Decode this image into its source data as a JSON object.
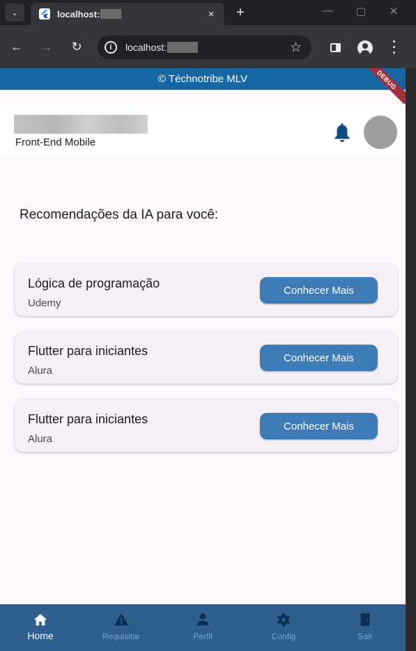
{
  "browser": {
    "tab_title": "localhost:",
    "new_tab_symbol": "+",
    "tab_close_symbol": "×",
    "url": "localhost:",
    "window_controls": [
      "—",
      "▢",
      "✕"
    ]
  },
  "app": {
    "banner": "© Téchnotribe MLV",
    "debug_label": "DEBUG",
    "header": {
      "role": "Front-End Mobile"
    },
    "section_title": "Recomendações da IA para você:",
    "recommendations": [
      {
        "title": "Lógica de programação",
        "provider": "Udemy",
        "button": "Conhecer Mais"
      },
      {
        "title": "Flutter para iniciantes",
        "provider": "Alura",
        "button": "Conhecer Mais"
      },
      {
        "title": "Flutter para iniciantes",
        "provider": "Alura",
        "button": "Conhecer Mais"
      }
    ],
    "bottom_nav": [
      {
        "label": "Home",
        "icon": "home-icon",
        "active": true
      },
      {
        "label": "Requisitar",
        "icon": "warning-icon",
        "active": false
      },
      {
        "label": "Perfil",
        "icon": "person-icon",
        "active": false
      },
      {
        "label": "Config",
        "icon": "gear-icon",
        "active": false
      },
      {
        "label": "Sair",
        "icon": "exit-door-icon",
        "active": false
      }
    ]
  },
  "colors": {
    "banner": "#1566a3",
    "bottom_nav": "#2e5f8d",
    "button": "#3f7cb7",
    "debug_ribbon": "#a2303d",
    "page_background": "#fdf7fb"
  }
}
